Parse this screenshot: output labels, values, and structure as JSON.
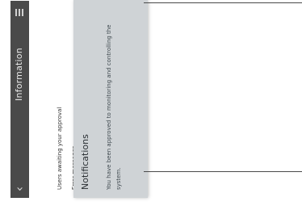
{
  "app_bar": {
    "title": "Information",
    "back_icon": "chevron-left-icon",
    "menu_icon": "menu-icon",
    "color": "#4a4a4a"
  },
  "list": {
    "items": [
      {
        "label": "Users awaiting your approval"
      },
      {
        "label": "Error messages"
      }
    ]
  },
  "notification_card": {
    "title": "Notifications",
    "message": "You have been approved to monitoring and controlling the system.",
    "color": "#cfd3d6"
  }
}
